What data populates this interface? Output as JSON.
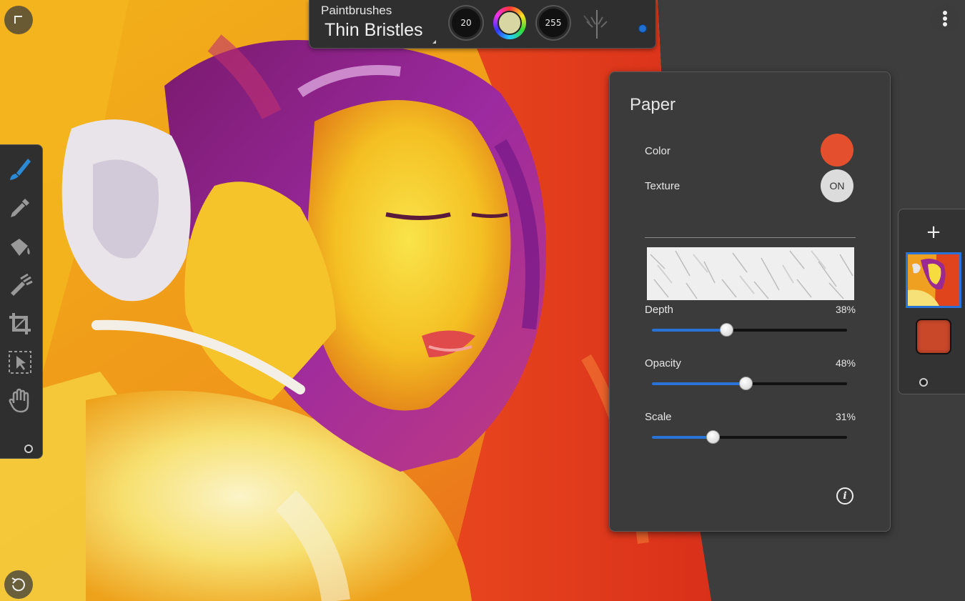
{
  "app": {
    "topbar": {
      "category": "Paintbrushes",
      "brush_name": "Thin Bristles",
      "size_value": "20",
      "opacity_value": "255",
      "current_color": "#d8d6a2"
    },
    "toolbar": {
      "tools": [
        "paintbrush-icon",
        "eyedropper-icon",
        "fill-bucket-icon",
        "smudge-icon",
        "crop-icon",
        "selection-icon",
        "hand-icon"
      ],
      "active_tool": "paintbrush-icon",
      "active_color": "#2a8ad6"
    },
    "paper_panel": {
      "title": "Paper",
      "color_label": "Color",
      "color_value": "#e4502e",
      "texture_label": "Texture",
      "texture_toggle": "ON",
      "sliders": [
        {
          "label": "Depth",
          "value_text": "38%",
          "value": 0.38
        },
        {
          "label": "Opacity",
          "value_text": "48%",
          "value": 0.48
        },
        {
          "label": "Scale",
          "value_text": "31%",
          "value": 0.31
        }
      ],
      "info_label": "i"
    },
    "layers_panel": {
      "add_label": "+",
      "layer_background_color": "#c9482a"
    },
    "accent_color": "#2a73d6"
  }
}
